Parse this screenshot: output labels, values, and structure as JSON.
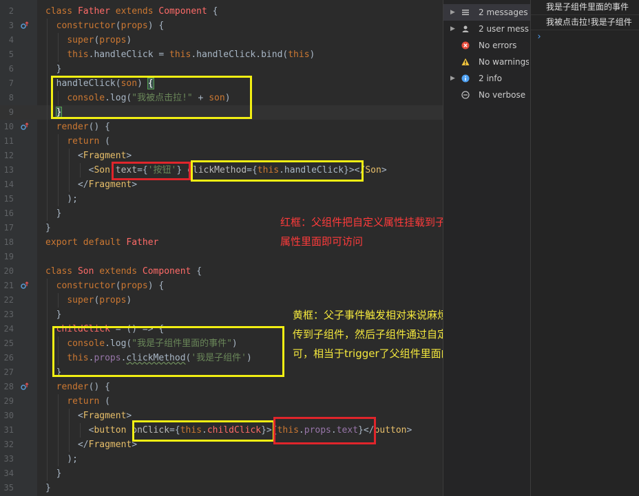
{
  "code": {
    "lines": [
      {
        "n": "2",
        "tokens": [
          {
            "c": "k",
            "t": "class "
          },
          {
            "c": "cl",
            "t": "Father "
          },
          {
            "c": "k",
            "t": "extends "
          },
          {
            "c": "cl",
            "t": "Component "
          },
          {
            "c": "t",
            "t": "{"
          }
        ]
      },
      {
        "n": "3",
        "tokens": [
          {
            "c": "t",
            "t": "  "
          },
          {
            "c": "k",
            "t": "constructor"
          },
          {
            "c": "t",
            "t": "("
          },
          {
            "c": "k",
            "t": "props"
          },
          {
            "c": "t",
            "t": ") {"
          }
        ]
      },
      {
        "n": "4",
        "tokens": [
          {
            "c": "t",
            "t": "    "
          },
          {
            "c": "k",
            "t": "super"
          },
          {
            "c": "t",
            "t": "("
          },
          {
            "c": "k",
            "t": "props"
          },
          {
            "c": "t",
            "t": ")"
          }
        ]
      },
      {
        "n": "5",
        "tokens": [
          {
            "c": "t",
            "t": "    "
          },
          {
            "c": "k",
            "t": "this"
          },
          {
            "c": "t",
            "t": ".handleClick = "
          },
          {
            "c": "k",
            "t": "this"
          },
          {
            "c": "t",
            "t": ".handleClick.bind("
          },
          {
            "c": "k",
            "t": "this"
          },
          {
            "c": "t",
            "t": ")"
          }
        ]
      },
      {
        "n": "6",
        "tokens": [
          {
            "c": "t",
            "t": "  }"
          }
        ]
      },
      {
        "n": "7",
        "tokens": [
          {
            "c": "t",
            "t": "  handleClick("
          },
          {
            "c": "k",
            "t": "son"
          },
          {
            "c": "t",
            "t": ") "
          },
          {
            "c": "ebrace",
            "t": "{"
          }
        ]
      },
      {
        "n": "8",
        "tokens": [
          {
            "c": "t",
            "t": "    "
          },
          {
            "c": "k",
            "t": "console"
          },
          {
            "c": "t",
            "t": ".log("
          },
          {
            "c": "str",
            "t": "\"我被点击拉!\""
          },
          {
            "c": "t",
            "t": " + "
          },
          {
            "c": "k",
            "t": "son"
          },
          {
            "c": "t",
            "t": ")"
          }
        ]
      },
      {
        "n": "9",
        "tokens": [
          {
            "c": "t",
            "t": "  "
          },
          {
            "c": "ebrace",
            "t": "}"
          }
        ]
      },
      {
        "n": "10",
        "tokens": [
          {
            "c": "t",
            "t": "  "
          },
          {
            "c": "k",
            "t": "render"
          },
          {
            "c": "t",
            "t": "() {"
          }
        ]
      },
      {
        "n": "11",
        "tokens": [
          {
            "c": "t",
            "t": "    "
          },
          {
            "c": "k",
            "t": "return "
          },
          {
            "c": "t",
            "t": "("
          }
        ]
      },
      {
        "n": "12",
        "tokens": [
          {
            "c": "t",
            "t": "      <"
          },
          {
            "c": "tag",
            "t": "Fragment"
          },
          {
            "c": "t",
            "t": ">"
          }
        ]
      },
      {
        "n": "13",
        "tokens": [
          {
            "c": "t",
            "t": "        <"
          },
          {
            "c": "tag",
            "t": "Son "
          },
          {
            "c": "attr",
            "t": "text"
          },
          {
            "c": "t",
            "t": "={"
          },
          {
            "c": "str",
            "t": "'按钮'"
          },
          {
            "c": "t",
            "t": "} "
          },
          {
            "c": "attr",
            "t": "clickMethod"
          },
          {
            "c": "t",
            "t": "={"
          },
          {
            "c": "k",
            "t": "this"
          },
          {
            "c": "t",
            "t": ".handleClick}></"
          },
          {
            "c": "tag",
            "t": "Son"
          },
          {
            "c": "t",
            "t": ">"
          }
        ]
      },
      {
        "n": "14",
        "tokens": [
          {
            "c": "t",
            "t": "      </"
          },
          {
            "c": "tag",
            "t": "Fragment"
          },
          {
            "c": "t",
            "t": ">"
          }
        ]
      },
      {
        "n": "15",
        "tokens": [
          {
            "c": "t",
            "t": "    );"
          }
        ]
      },
      {
        "n": "16",
        "tokens": [
          {
            "c": "t",
            "t": "  }"
          }
        ]
      },
      {
        "n": "17",
        "tokens": [
          {
            "c": "t",
            "t": "}"
          }
        ]
      },
      {
        "n": "18",
        "tokens": [
          {
            "c": "k",
            "t": "export default "
          },
          {
            "c": "cl",
            "t": "Father"
          }
        ]
      },
      {
        "n": "19",
        "tokens": []
      },
      {
        "n": "20",
        "tokens": [
          {
            "c": "k",
            "t": "class "
          },
          {
            "c": "cl",
            "t": "Son "
          },
          {
            "c": "k",
            "t": "extends "
          },
          {
            "c": "cl",
            "t": "Component "
          },
          {
            "c": "t",
            "t": "{"
          }
        ]
      },
      {
        "n": "21",
        "tokens": [
          {
            "c": "t",
            "t": "  "
          },
          {
            "c": "k",
            "t": "constructor"
          },
          {
            "c": "t",
            "t": "("
          },
          {
            "c": "k",
            "t": "props"
          },
          {
            "c": "t",
            "t": ") {"
          }
        ]
      },
      {
        "n": "22",
        "tokens": [
          {
            "c": "t",
            "t": "    "
          },
          {
            "c": "k",
            "t": "super"
          },
          {
            "c": "t",
            "t": "("
          },
          {
            "c": "k",
            "t": "props"
          },
          {
            "c": "t",
            "t": ")"
          }
        ]
      },
      {
        "n": "23",
        "tokens": [
          {
            "c": "t",
            "t": "  }"
          }
        ]
      },
      {
        "n": "24",
        "tokens": [
          {
            "c": "t",
            "t": "  "
          },
          {
            "c": "cl",
            "t": "childClick"
          },
          {
            "c": "t",
            "t": " = () => {"
          }
        ]
      },
      {
        "n": "25",
        "tokens": [
          {
            "c": "t",
            "t": "    "
          },
          {
            "c": "k",
            "t": "console"
          },
          {
            "c": "t",
            "t": ".log("
          },
          {
            "c": "str",
            "t": "\"我是子组件里面的事件\""
          },
          {
            "c": "t",
            "t": ")"
          }
        ]
      },
      {
        "n": "26",
        "tokens": [
          {
            "c": "t",
            "t": "    "
          },
          {
            "c": "k",
            "t": "this"
          },
          {
            "c": "t",
            "t": "."
          },
          {
            "c": "prop",
            "t": "props"
          },
          {
            "c": "t",
            "t": "."
          },
          {
            "c": "wavy",
            "t": "clickMethod"
          },
          {
            "c": "t",
            "t": "("
          },
          {
            "c": "str",
            "t": "'我是子组件'"
          },
          {
            "c": "t",
            "t": ")"
          }
        ]
      },
      {
        "n": "27",
        "tokens": [
          {
            "c": "t",
            "t": "  }"
          }
        ]
      },
      {
        "n": "28",
        "tokens": [
          {
            "c": "t",
            "t": "  "
          },
          {
            "c": "k",
            "t": "render"
          },
          {
            "c": "t",
            "t": "() {"
          }
        ]
      },
      {
        "n": "29",
        "tokens": [
          {
            "c": "t",
            "t": "    "
          },
          {
            "c": "k",
            "t": "return "
          },
          {
            "c": "t",
            "t": "("
          }
        ]
      },
      {
        "n": "30",
        "tokens": [
          {
            "c": "t",
            "t": "      <"
          },
          {
            "c": "tag",
            "t": "Fragment"
          },
          {
            "c": "t",
            "t": ">"
          }
        ]
      },
      {
        "n": "31",
        "tokens": [
          {
            "c": "t",
            "t": "        <"
          },
          {
            "c": "tag",
            "t": "button "
          },
          {
            "c": "attr",
            "t": "onClick"
          },
          {
            "c": "t",
            "t": "={"
          },
          {
            "c": "k",
            "t": "this"
          },
          {
            "c": "t",
            "t": "."
          },
          {
            "c": "cl",
            "t": "childClick"
          },
          {
            "c": "t",
            "t": "}>{"
          },
          {
            "c": "k",
            "t": "this"
          },
          {
            "c": "t",
            "t": "."
          },
          {
            "c": "prop",
            "t": "props"
          },
          {
            "c": "t",
            "t": "."
          },
          {
            "c": "prop",
            "t": "text"
          },
          {
            "c": "t",
            "t": "}</"
          },
          {
            "c": "tag",
            "t": "button"
          },
          {
            "c": "t",
            "t": ">"
          }
        ]
      },
      {
        "n": "32",
        "tokens": [
          {
            "c": "t",
            "t": "      </"
          },
          {
            "c": "tag",
            "t": "Fragment"
          },
          {
            "c": "t",
            "t": ">"
          }
        ]
      },
      {
        "n": "33",
        "tokens": [
          {
            "c": "t",
            "t": "    );"
          }
        ]
      },
      {
        "n": "34",
        "tokens": [
          {
            "c": "t",
            "t": "  }"
          }
        ]
      },
      {
        "n": "35",
        "tokens": [
          {
            "c": "t",
            "t": "}"
          }
        ]
      }
    ]
  },
  "annotations": {
    "red": "红框：父组件把自定义属性挂载到子组件的props属性里面即可访问",
    "yellow": "黄框：父子事件触发相对来说麻烦一些，首先要把方法类似于传值一样传到子组件，然后子组件通过自定义一个事件再调用之前传入的方法即可，相当于trigger了父组件里面的方法。"
  },
  "console_sidebar": {
    "items": [
      {
        "label": "2 messages",
        "icon": "list-icon",
        "expandable": true,
        "selected": true
      },
      {
        "label": "2 user messages",
        "icon": "user-icon",
        "expandable": true,
        "selected": false
      },
      {
        "label": "No errors",
        "icon": "error-icon",
        "expandable": false,
        "selected": false
      },
      {
        "label": "No warnings",
        "icon": "warning-icon",
        "expandable": false,
        "selected": false
      },
      {
        "label": "2 info",
        "icon": "info-icon",
        "expandable": true,
        "selected": false
      },
      {
        "label": "No verbose",
        "icon": "verbose-icon",
        "expandable": false,
        "selected": false
      }
    ]
  },
  "console_output": {
    "lines": [
      "我是子组件里面的事件",
      "我被点击拉!我是子组件"
    ],
    "prompt": "›"
  },
  "colors": {
    "yellow_box": "#f2ef13",
    "red_box": "#e0252b",
    "error": "#e74c3c",
    "warning": "#f0c33c",
    "info": "#4ea1f3"
  }
}
